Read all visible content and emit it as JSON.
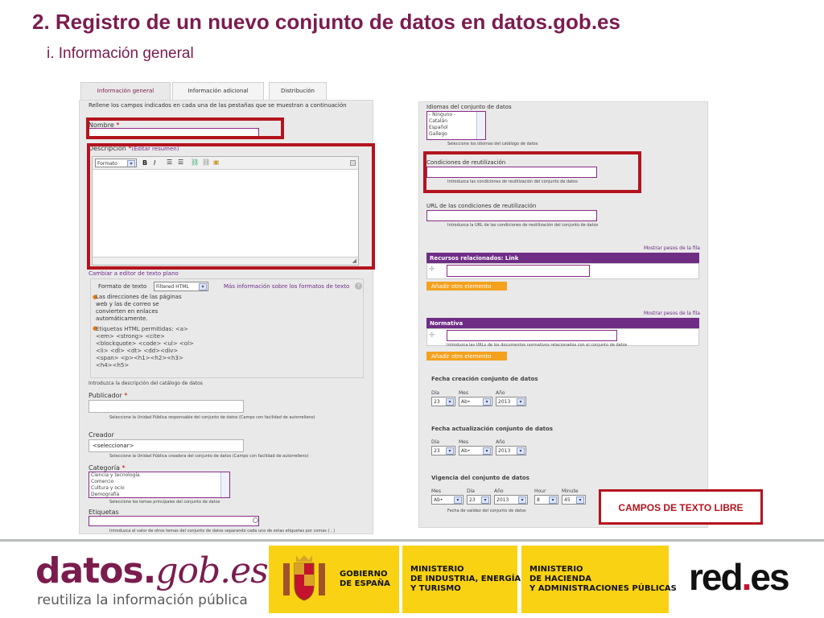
{
  "slide": {
    "title": "2. Registro de un nuevo conjunto de datos en datos.gob.es",
    "subtitle": "i. Información general"
  },
  "left_form": {
    "tabs": [
      "Información general",
      "Información adicional",
      "Distribución"
    ],
    "intro": "Rellene los campos indicados en cada una de las pestañas que se muestran a continuación",
    "nombre_label": "Nombre",
    "required_mark": "*",
    "descripcion_label": "Descripción",
    "editar_resumen": "(Editar resumen)",
    "editor_format": "Formato",
    "cambiar_editor": "Cambiar a editor de texto plano",
    "formato_texto_label": "Formato de texto",
    "formato_texto_value": "Filtered HTML",
    "mas_info": "Más información sobre los formatos de texto",
    "help_1": "Las direcciones de las páginas web y las de correo se convierten en enlaces automáticamente.",
    "help_2": "Etiquetas HTML permitidas: <a> <em> <strong> <cite> <blockquote> <code> <ul> <ol> <li> <dl> <dt> <dd><div><span> <p><h1><h2><h3><h4><h5>",
    "desc_hint": "Introduzca la descripción del catálogo de datos",
    "publicador_label": "Publicador",
    "publicador_hint": "Seleccione la Unidad Pública responsable del conjunto de datos (Campo con facilidad de autorrelleno)",
    "creador_label": "Creador",
    "creador_value": "<seleccionar>",
    "creador_hint": "Seleccione la Unidad Pública creadora del conjunto de datos (Campo con facilidad de autorrelleno)",
    "categoria_label": "Categoría",
    "categoria_options": [
      "Ciencia y tecnología",
      "Comercio",
      "Cultura y ocio",
      "Demografía"
    ],
    "categoria_hint": "Seleccione los temas principales del conjunto de datos",
    "etiquetas_label": "Etiquetas",
    "etiquetas_hint": "Introduzca el valor de otros temas del conjunto de datos separando cada uno de estas etiquetas por comas ( , )"
  },
  "right_form": {
    "idiomas_label": "Idiomas del conjunto de datos",
    "idiomas_options": [
      "- Ninguno -",
      "Catalán",
      "Español",
      "Gallego"
    ],
    "idiomas_hint": "Seleccione los idiomas del catálogo de datos",
    "condiciones_label": "Condiciones de reutilización",
    "condiciones_hint": "Introduzca las condiciones de reutilización del conjunto de datos",
    "url_label": "URL de las condiciones de reutilización",
    "url_hint": "Introduzca la URL de las condiciones de reutilización del conjunto de datos",
    "mostrar_pesos": "Mostrar pesos de la fila",
    "recursos_label": "Recursos relacionados: Link",
    "anadir": "Añadir otro elemento",
    "normativa_label": "Normativa",
    "normativa_hint": "Introduzca las URLs de los documentos normativos relacionados con el conjunto de datos",
    "fecha_creacion_label": "Fecha creación conjunto de datos",
    "fecha_actualizacion_label": "Fecha actualización conjunto de datos",
    "vigencia_label": "Vigencia del conjunto de datos",
    "vigencia_hint": "Fecha de validez del conjunto de datos",
    "dia_label": "Día",
    "mes_label": "Mes",
    "ano_label": "Año",
    "hora_label": "Hour",
    "minuto_label": "Minute",
    "dia_value": "23",
    "mes_value": "Ab•",
    "ano_value": "2013",
    "hora_value": "8",
    "minuto_value": "45"
  },
  "callout": "CAMPOS DE TEXTO LIBRE",
  "footer": {
    "logo_main": "datos.",
    "logo_italic": "gob.es",
    "tagline": "reutiliza la información pública",
    "gobierno": "GOBIERNO\nDE ESPAÑA",
    "ministerio_1": "MINISTERIO\nDE INDUSTRIA, ENERGÍA\nY TURISMO",
    "ministerio_2": "MINISTERIO\nDE HACIENDA\nY ADMINISTRACIONES PÚBLICAS",
    "redes_a": "red",
    "redes_dot": ".",
    "redes_b": "es"
  },
  "colors": {
    "accent": "#7b1c4e",
    "highlight": "#b4141e",
    "purple_bar": "#6f2d86",
    "orange_button": "#f4a11c",
    "gov_yellow": "#f9d213"
  }
}
